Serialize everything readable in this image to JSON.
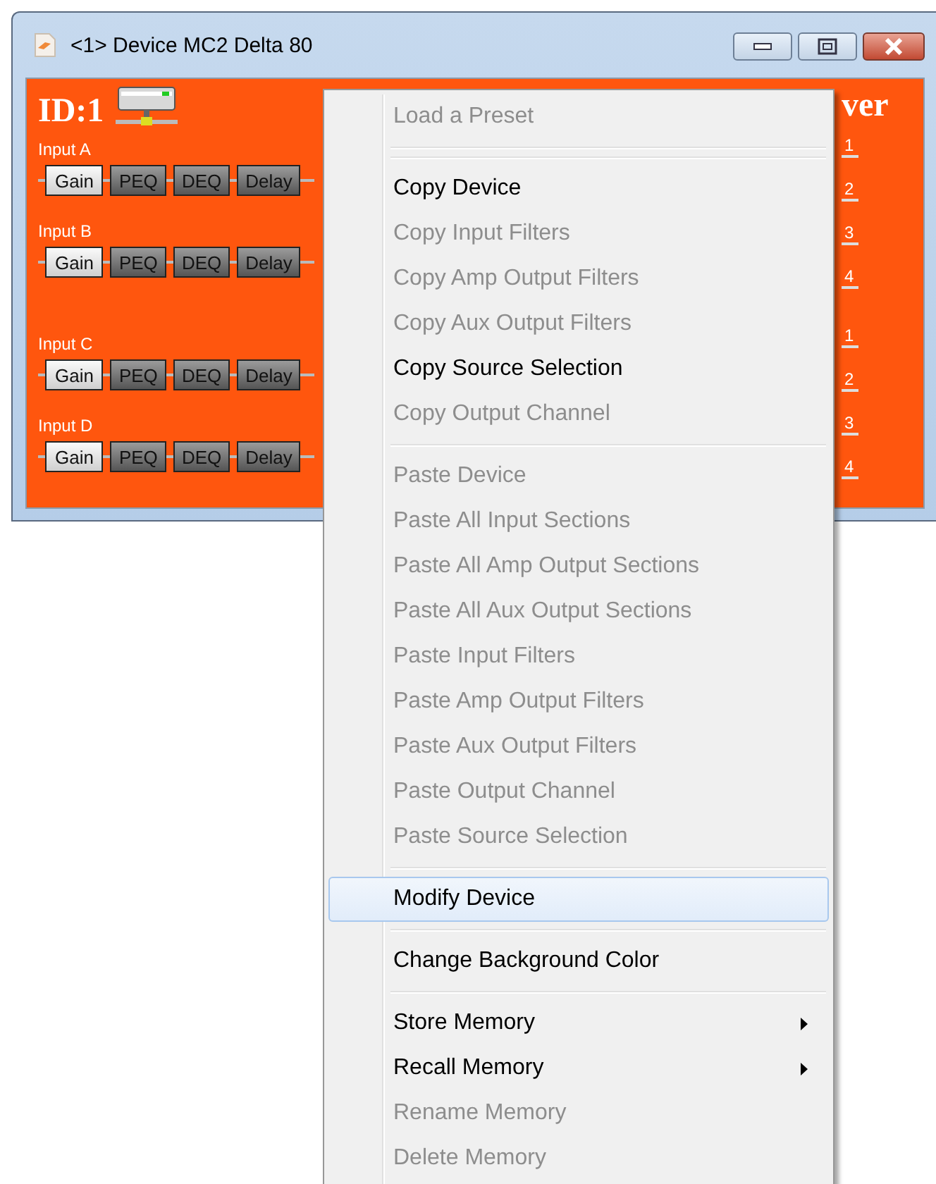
{
  "window": {
    "title": "<1> Device MC2 Delta 80"
  },
  "device": {
    "id": "ID:1",
    "inputs": [
      {
        "label": "Input A",
        "blocks": [
          {
            "label": "Gain",
            "active": true
          },
          {
            "label": "PEQ",
            "active": false
          },
          {
            "label": "DEQ",
            "active": false
          },
          {
            "label": "Delay",
            "active": false
          }
        ]
      },
      {
        "label": "Input B",
        "blocks": [
          {
            "label": "Gain",
            "active": true
          },
          {
            "label": "PEQ",
            "active": false
          },
          {
            "label": "DEQ",
            "active": false
          },
          {
            "label": "Delay",
            "active": false
          }
        ]
      },
      {
        "label": "Input C",
        "blocks": [
          {
            "label": "Gain",
            "active": true
          },
          {
            "label": "PEQ",
            "active": false
          },
          {
            "label": "DEQ",
            "active": false
          },
          {
            "label": "Delay",
            "active": false
          }
        ]
      },
      {
        "label": "Input D",
        "blocks": [
          {
            "label": "Gain",
            "active": true
          },
          {
            "label": "PEQ",
            "active": false
          },
          {
            "label": "DEQ",
            "active": false
          },
          {
            "label": "Delay",
            "active": false
          }
        ]
      }
    ],
    "output_heading": "ver",
    "output_groups": [
      [
        "1",
        "2",
        "3",
        "4"
      ],
      [
        "1",
        "2",
        "3",
        "4"
      ]
    ]
  },
  "context_menu": {
    "items": [
      {
        "kind": "item",
        "label": "Load a Preset",
        "disabled": true,
        "selected": false,
        "submenu": false
      },
      {
        "kind": "separator"
      },
      {
        "kind": "separator"
      },
      {
        "kind": "item",
        "label": "Copy Device",
        "disabled": false,
        "selected": false,
        "submenu": false
      },
      {
        "kind": "item",
        "label": "Copy Input Filters",
        "disabled": true,
        "selected": false,
        "submenu": false
      },
      {
        "kind": "item",
        "label": "Copy Amp Output Filters",
        "disabled": true,
        "selected": false,
        "submenu": false
      },
      {
        "kind": "item",
        "label": "Copy Aux Output Filters",
        "disabled": true,
        "selected": false,
        "submenu": false
      },
      {
        "kind": "item",
        "label": "Copy Source Selection",
        "disabled": false,
        "selected": false,
        "submenu": false
      },
      {
        "kind": "item",
        "label": "Copy Output Channel",
        "disabled": true,
        "selected": false,
        "submenu": false
      },
      {
        "kind": "separator"
      },
      {
        "kind": "item",
        "label": "Paste Device",
        "disabled": true,
        "selected": false,
        "submenu": false
      },
      {
        "kind": "item",
        "label": "Paste All Input Sections",
        "disabled": true,
        "selected": false,
        "submenu": false
      },
      {
        "kind": "item",
        "label": "Paste All Amp Output Sections",
        "disabled": true,
        "selected": false,
        "submenu": false
      },
      {
        "kind": "item",
        "label": "Paste All Aux Output Sections",
        "disabled": true,
        "selected": false,
        "submenu": false
      },
      {
        "kind": "item",
        "label": "Paste Input Filters",
        "disabled": true,
        "selected": false,
        "submenu": false
      },
      {
        "kind": "item",
        "label": "Paste Amp Output Filters",
        "disabled": true,
        "selected": false,
        "submenu": false
      },
      {
        "kind": "item",
        "label": "Paste Aux Output Filters",
        "disabled": true,
        "selected": false,
        "submenu": false
      },
      {
        "kind": "item",
        "label": "Paste Output Channel",
        "disabled": true,
        "selected": false,
        "submenu": false
      },
      {
        "kind": "item",
        "label": "Paste Source Selection",
        "disabled": true,
        "selected": false,
        "submenu": false
      },
      {
        "kind": "separator"
      },
      {
        "kind": "item",
        "label": "Modify Device",
        "disabled": false,
        "selected": true,
        "submenu": false
      },
      {
        "kind": "separator"
      },
      {
        "kind": "item",
        "label": "Change Background Color",
        "disabled": false,
        "selected": false,
        "submenu": false
      },
      {
        "kind": "separator"
      },
      {
        "kind": "item",
        "label": "Store Memory",
        "disabled": false,
        "selected": false,
        "submenu": true
      },
      {
        "kind": "item",
        "label": "Recall Memory",
        "disabled": false,
        "selected": false,
        "submenu": true
      },
      {
        "kind": "item",
        "label": "Rename Memory",
        "disabled": true,
        "selected": false,
        "submenu": false
      },
      {
        "kind": "item",
        "label": "Delete Memory",
        "disabled": true,
        "selected": false,
        "submenu": false
      }
    ]
  }
}
